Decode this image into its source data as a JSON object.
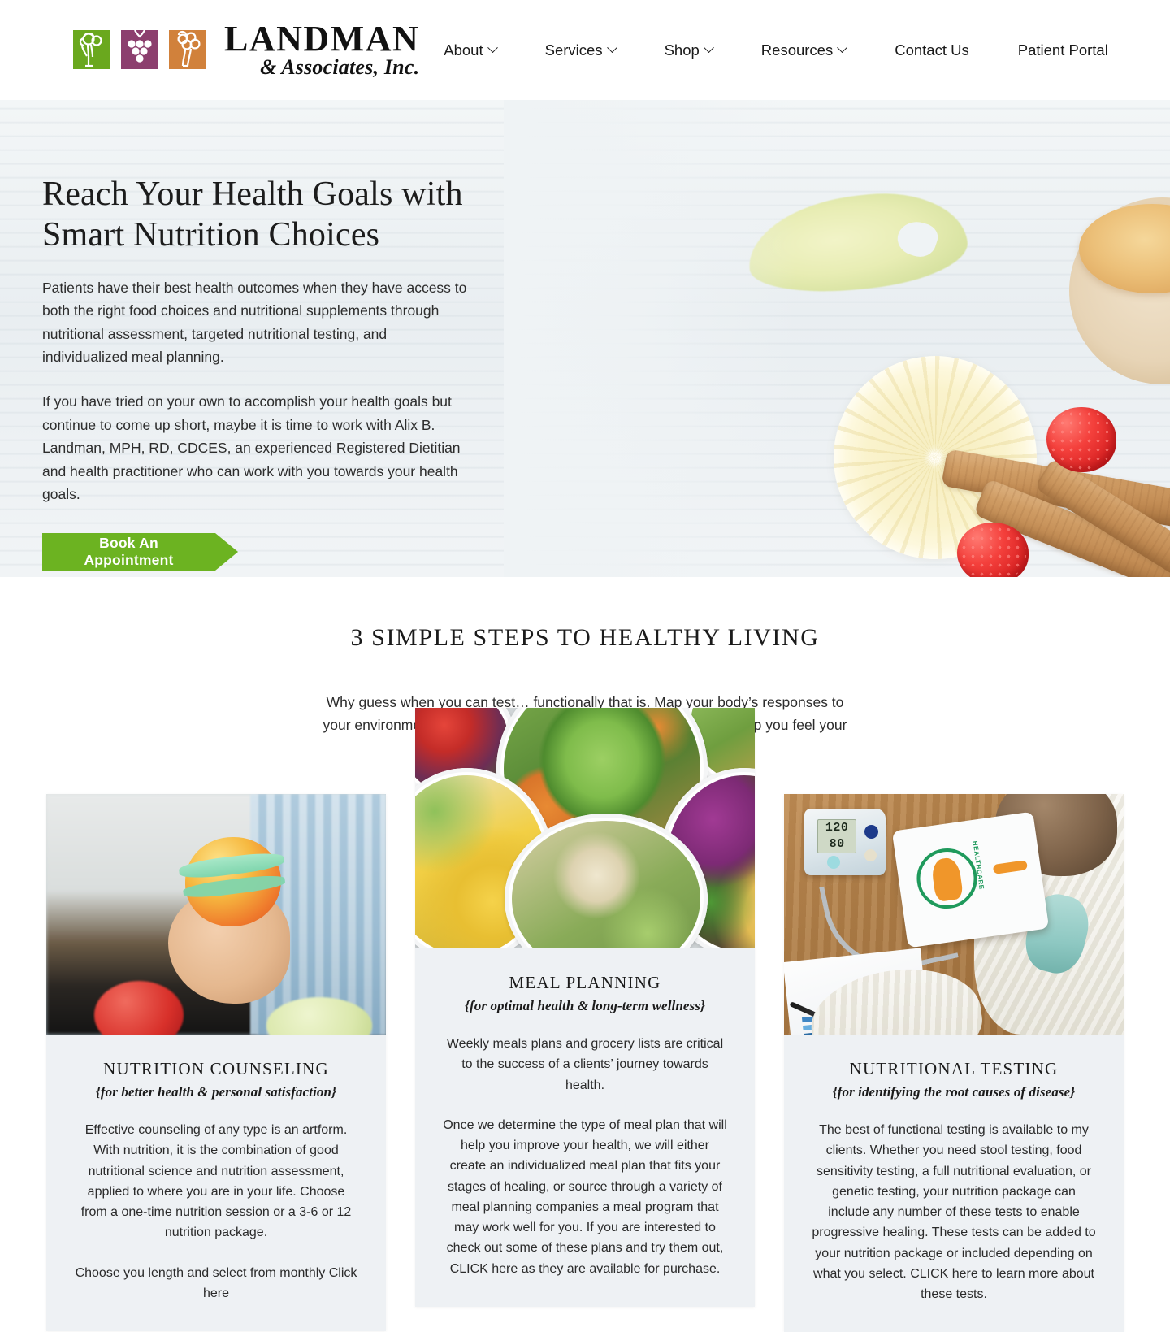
{
  "header": {
    "brand": {
      "name": "LANDMAN",
      "tagline": "& Associates, Inc.",
      "tiles": [
        "broccoli-tile",
        "grapes-tile",
        "hand-tile"
      ]
    },
    "nav": [
      {
        "label": "About",
        "has_caret": true
      },
      {
        "label": "Services",
        "has_caret": true
      },
      {
        "label": "Shop",
        "has_caret": true
      },
      {
        "label": "Resources",
        "has_caret": true
      },
      {
        "label": "Contact Us",
        "has_caret": false
      },
      {
        "label": "Patient Portal",
        "has_caret": false
      }
    ]
  },
  "hero": {
    "title": "Reach Your Health Goals with Smart Nutrition Choices",
    "paragraph1": "Patients have their best health outcomes when they have access to both the right food choices and nutritional supplements through nutritional assessment, targeted nutritional testing, and individualized meal planning.",
    "paragraph2": "If you have tried on your own to accomplish your health goals but continue to come up short, maybe it is time to work with Alix B. Landman, MPH, RD, CDCES, an experienced Registered Dietitian and health practitioner who can work with you towards your health goals.",
    "cta_label": "Book An Appointment",
    "cta_color": "#6cb321"
  },
  "steps": {
    "title": "3 SIMPLE STEPS TO HEALTHY LIVING",
    "subtitle": "Why guess when you can test… functionally that is. Map your body’s responses to your environment to determine the right food and supplements to help you feel your best.",
    "cards": [
      {
        "title": "NUTRITION COUNSELING",
        "subtitle": "{for better health & personal satisfaction}",
        "body1": "Effective counseling of any type is an artform. With nutrition, it is the combination of good nutritional science and nutrition assessment, applied to where you are in your life. Choose from a one-time nutrition session or a 3-6 or 12 nutrition package.",
        "body2": "Choose you length and select from monthly Click here"
      },
      {
        "title": "MEAL PLANNING",
        "subtitle": "{for optimal health & long-term wellness}",
        "body1": "Weekly meals plans and grocery lists are critical to the success of a clients’ journey towards health.",
        "body2": "Once we determine the type of meal plan that will help you improve your health, we will either create an individualized meal plan that fits your stages of healing, or source through a variety of meal planning companies a meal program that may work well for you. If you are interested to check out some of these plans and try them out, CLICK here as they are available for purchase."
      },
      {
        "title": "NUTRITIONAL TESTING",
        "subtitle": "{for identifying the root causes of disease}",
        "body1": "The best of functional testing is available to my clients. Whether you need stool testing, food sensitivity testing, a full nutritional evaluation, or genetic testing, your nutrition package can include any number of these tests to enable progressive healing. These tests can be added to your nutrition package or included depending on what you select. CLICK here to learn more about these tests."
      }
    ]
  },
  "card_images": {
    "card1_alt": "hand-holding-apple-with-measuring-tape",
    "card2_alt": "assorted-salad-bowls-overhead",
    "card3_alt": "blood-pressure-monitor-and-tablet",
    "bp_reading_systolic": "120",
    "bp_reading_diastolic": "80",
    "tablet_app_label": "HEALTHCARE"
  }
}
